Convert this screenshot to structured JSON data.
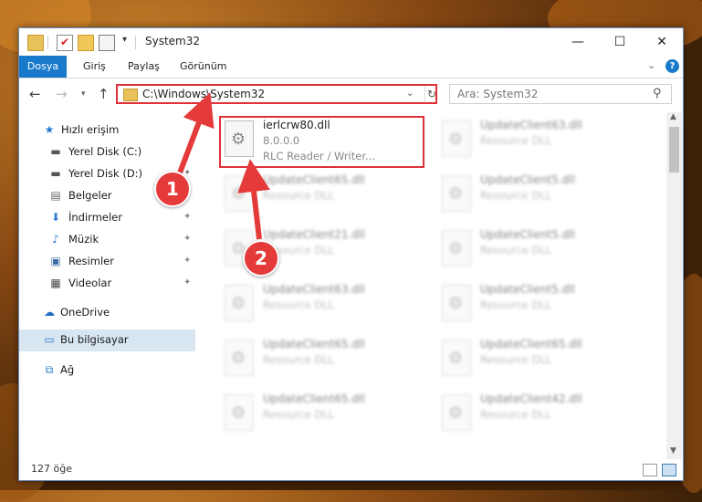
{
  "window": {
    "title": "System32",
    "controls": {
      "minimize": "—",
      "maximize": "☐",
      "close": "✕"
    }
  },
  "ribbon": {
    "tabs": [
      "Dosya",
      "Giriş",
      "Paylaş",
      "Görünüm"
    ],
    "help": "?"
  },
  "nav": {
    "address": "C:\\Windows\\System32",
    "search_placeholder": "Ara: System32"
  },
  "sidebar": {
    "items": [
      {
        "label": "Hızlı erişim",
        "icon": "star-icon"
      },
      {
        "label": "Yerel Disk (C:)",
        "icon": "drive-icon",
        "pinned": true
      },
      {
        "label": "Yerel Disk (D:)",
        "icon": "drive-icon",
        "pinned": true
      },
      {
        "label": "Belgeler",
        "icon": "document-icon",
        "pinned": true
      },
      {
        "label": "İndirmeler",
        "icon": "download-icon",
        "pinned": true
      },
      {
        "label": "Müzik",
        "icon": "music-icon",
        "pinned": true
      },
      {
        "label": "Resimler",
        "icon": "pictures-icon",
        "pinned": true
      },
      {
        "label": "Videolar",
        "icon": "video-icon",
        "pinned": true
      },
      {
        "label": "OneDrive",
        "icon": "cloud-icon"
      },
      {
        "label": "Bu bilgisayar",
        "icon": "computer-icon",
        "selected": true
      },
      {
        "label": "Ağ",
        "icon": "network-icon"
      }
    ]
  },
  "files": {
    "highlighted": {
      "name": "ierlcrw80.dll",
      "version": "8.0.0.0",
      "desc": "RLC Reader / Writer..."
    },
    "left_column": [
      {
        "name": "UpdateClient65.dll",
        "desc": "Resource DLL"
      },
      {
        "name": "UpdateClient21.dll",
        "desc": "Resource DLL"
      },
      {
        "name": "UpdateClient63.dll",
        "desc": "Resource DLL"
      },
      {
        "name": "UpdateClient65.dll",
        "desc": "Resource DLL"
      },
      {
        "name": "UpdateClient65.dll",
        "desc": "Resource DLL"
      }
    ],
    "right_column": [
      {
        "name": "UpdateClient63.dll",
        "desc": "Resource DLL"
      },
      {
        "name": "UpdateClient5.dll",
        "desc": "Resource DLL"
      },
      {
        "name": "UpdateClient5.dll",
        "desc": "Resource DLL"
      },
      {
        "name": "UpdateClient5.dll",
        "desc": "Resource DLL"
      },
      {
        "name": "UpdateClient65.dll",
        "desc": "Resource DLL"
      },
      {
        "name": "UpdateClient42.dll",
        "desc": "Resource DLL"
      }
    ]
  },
  "status": {
    "count": "127 öğe"
  },
  "callouts": [
    "1",
    "2"
  ],
  "colors": {
    "accent": "#1979ca",
    "highlight": "#e0303a",
    "callout": "#e53a3a"
  }
}
